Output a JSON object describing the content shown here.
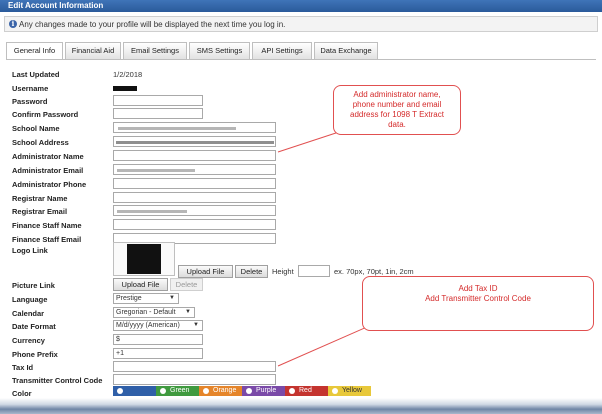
{
  "window": {
    "title": "Edit Account Information"
  },
  "info": {
    "text": "Any changes made to your profile will be displayed the next time you log in."
  },
  "tabs": [
    "General Info",
    "Financial Aid",
    "Email Settings",
    "SMS Settings",
    "API Settings",
    "Data Exchange"
  ],
  "form": {
    "last_updated_label": "Last Updated",
    "last_updated_value": "1/2/2018",
    "username_label": "Username",
    "password_label": "Password",
    "confirm_password_label": "Confirm Password",
    "school_name_label": "School Name",
    "school_address_label": "School Address",
    "admin_name_label": "Administrator Name",
    "admin_email_label": "Administrator Email",
    "admin_phone_label": "Administrator Phone",
    "registrar_name_label": "Registrar Name",
    "registrar_email_label": "Registrar Email",
    "finance_name_label": "Finance Staff Name",
    "finance_email_label": "Finance Staff Email",
    "logo_link_label": "Logo Link",
    "upload_file": "Upload File",
    "delete": "Delete",
    "height_label": "Height",
    "height_hint": "ex. 70px, 70pt, 1in, 2cm",
    "picture_link_label": "Picture Link",
    "language_label": "Language",
    "language_value": "Prestige",
    "calendar_label": "Calendar",
    "calendar_value": "Gregorian - Default",
    "date_format_label": "Date Format",
    "date_format_value": "M/d/yyyy (American)",
    "currency_label": "Currency",
    "currency_value": "$",
    "phone_prefix_label": "Phone Prefix",
    "phone_prefix_value": "+1",
    "tax_id_label": "Tax Id",
    "tcc_label": "Transmitter Control Code",
    "color_label": "Color"
  },
  "colors": [
    {
      "name": "",
      "hex": "#2f5fa8"
    },
    {
      "name": "Green",
      "hex": "#3f9a3f"
    },
    {
      "name": "Orange",
      "hex": "#e5852a"
    },
    {
      "name": "Purple",
      "hex": "#7a4aa8"
    },
    {
      "name": "Red",
      "hex": "#c4342f"
    },
    {
      "name": "Yellow",
      "hex": "#e8c83a"
    }
  ],
  "callouts": {
    "first": "Add administrator name, phone number and email address for 1098 T Extract data.",
    "second_line1": "Add Tax ID",
    "second_line2": "Add Transmitter Control Code"
  }
}
